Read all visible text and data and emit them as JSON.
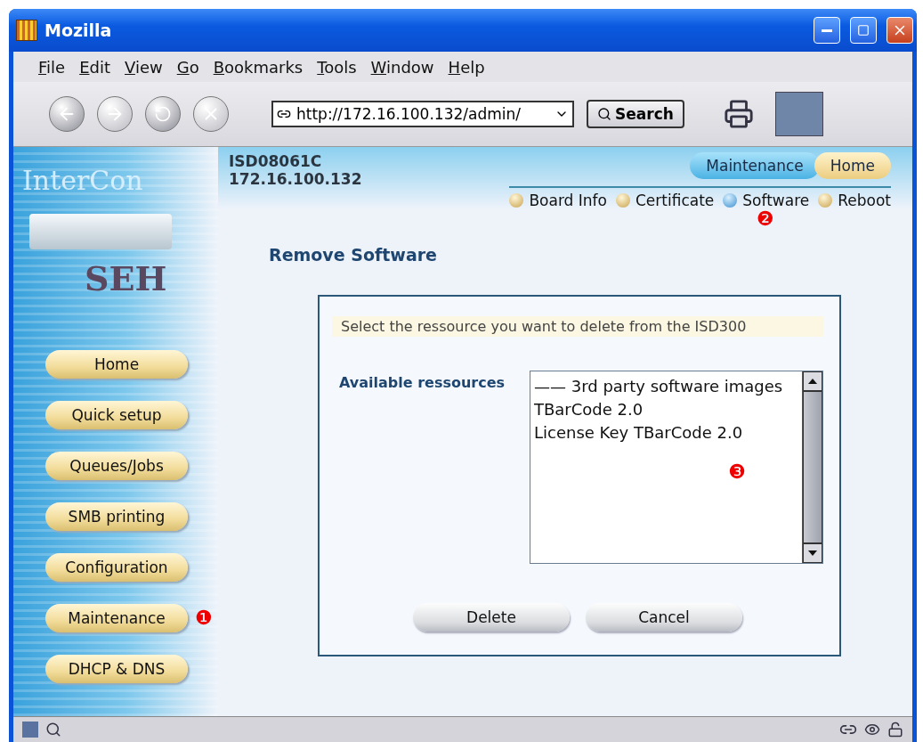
{
  "window": {
    "title": "Mozilla"
  },
  "menu": [
    "File",
    "Edit",
    "View",
    "Go",
    "Bookmarks",
    "Tools",
    "Window",
    "Help"
  ],
  "toolbar": {
    "url": "http://172.16.100.132/admin/",
    "search_button": "Search"
  },
  "logo": {
    "brand": "InterCon",
    "maker": "SEH"
  },
  "device": {
    "name": "ISD08061C",
    "ip": "172.16.100.132"
  },
  "top_nav": [
    {
      "label": "Maintenance",
      "selected": true
    },
    {
      "label": "Home",
      "selected": false
    }
  ],
  "sub_nav": [
    {
      "label": "Board Info",
      "selected": false
    },
    {
      "label": "Certificate",
      "selected": false
    },
    {
      "label": "Software",
      "selected": true,
      "callout": "❷"
    },
    {
      "label": "Reboot",
      "selected": false
    }
  ],
  "sidebar": {
    "items": [
      {
        "label": "Home"
      },
      {
        "label": "Quick setup"
      },
      {
        "label": "Queues/Jobs"
      },
      {
        "label": "SMB printing"
      },
      {
        "label": "Configuration"
      },
      {
        "label": "Maintenance",
        "callout": "❶"
      },
      {
        "label": "DHCP & DNS"
      }
    ]
  },
  "page_title": "Remove Software",
  "form": {
    "instruction": "Select the ressource you want to delete from the ISD300",
    "field_label": "Available ressources",
    "listbox": {
      "callout": "❸",
      "items": [
        "—— 3rd party software images",
        "TBarCode 2.0",
        "License Key TBarCode 2.0"
      ]
    },
    "buttons": [
      "Delete",
      "Cancel"
    ]
  }
}
